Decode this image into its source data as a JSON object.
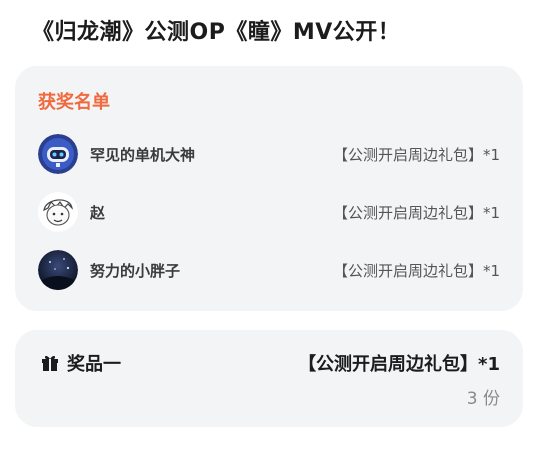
{
  "page": {
    "title": "《归龙潮》公测OP《瞳》MV公开！"
  },
  "winners": {
    "title": "获奖名单",
    "items": [
      {
        "name": "罕见的单机大神",
        "reward": "【公测开启周边礼包】*1",
        "avatar": "robot-avatar"
      },
      {
        "name": "赵",
        "reward": "【公测开启周边礼包】*1",
        "avatar": "sketch-face-avatar"
      },
      {
        "name": "努力的小胖子",
        "reward": "【公测开启周边礼包】*1",
        "avatar": "night-sky-avatar"
      }
    ]
  },
  "prize": {
    "icon": "gift-icon",
    "label": "奖品一",
    "name": "【公测开启周边礼包】*1",
    "count": "3 份"
  },
  "colors": {
    "accent": "#f06a3e",
    "card_bg": "#f3f4f6"
  }
}
